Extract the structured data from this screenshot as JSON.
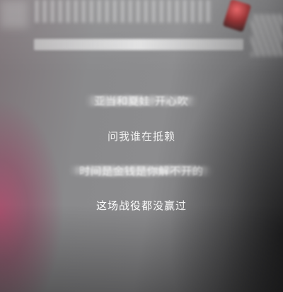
{
  "player": {
    "lyrics": [
      {
        "text": "",
        "state": "blurred"
      },
      {
        "text": "亚当和夏娃 开心吹",
        "state": "blurred"
      },
      {
        "text": "问我谁在抵赖",
        "state": "dim"
      },
      {
        "text": "时间是金钱是你解不开的",
        "state": "blurred"
      },
      {
        "text": "这场战役都没赢过",
        "state": "current"
      },
      {
        "text": "",
        "state": "heavy-blur"
      },
      {
        "text": "",
        "state": "heavy-blur"
      }
    ]
  }
}
